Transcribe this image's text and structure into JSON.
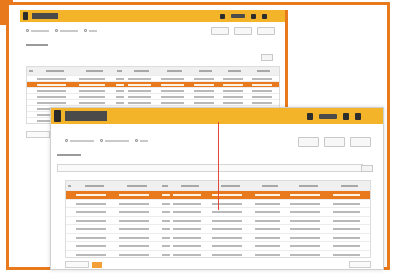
{
  "app": {
    "name": "",
    "accent_color": "#e8791d",
    "topbar_color": "#f3b42a"
  },
  "window_back": {
    "nav_icons": [
      "alert-icon",
      "user-icon",
      "logout-icon"
    ],
    "filters": [
      "",
      "",
      ""
    ],
    "toolbar_buttons": [
      "",
      "",
      ""
    ],
    "section_title": "",
    "filter_button": "",
    "columns": [
      "",
      "",
      "",
      "",
      "",
      "",
      "",
      ""
    ],
    "rows": 8,
    "selected_row": 1,
    "footer": ""
  },
  "window_front": {
    "nav_icons": [
      "alert-icon",
      "user-icon",
      "settings-icon"
    ],
    "filters": [
      "",
      "",
      ""
    ],
    "toolbar_buttons": [
      "",
      "",
      ""
    ],
    "section_title": "",
    "search_placeholder": "",
    "filter_button": "",
    "columns": [
      "",
      "",
      "",
      "",
      "",
      "",
      "",
      "",
      ""
    ],
    "rows": 8,
    "selected_row": 0,
    "pager": "",
    "page_info": ""
  }
}
